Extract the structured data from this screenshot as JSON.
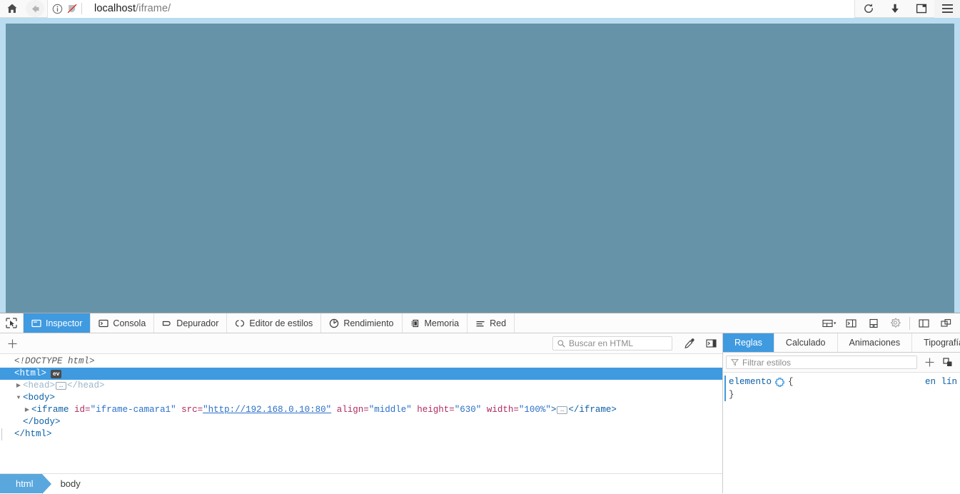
{
  "browser": {
    "home_tooltip": "Inicio",
    "back_tooltip": "Atrás",
    "url_host": "localhost",
    "url_path": "/iframe/",
    "reload_tooltip": "Recargar",
    "downloads_tooltip": "Descargas",
    "library_tooltip": "Biblioteca",
    "menu_tooltip": "Menú"
  },
  "devtools": {
    "tabs": [
      {
        "label": "Inspector",
        "icon": "inspector-icon",
        "active": true
      },
      {
        "label": "Consola",
        "icon": "console-icon",
        "active": false
      },
      {
        "label": "Depurador",
        "icon": "debugger-icon",
        "active": false
      },
      {
        "label": "Editor de estilos",
        "icon": "style-editor-icon",
        "active": false
      },
      {
        "label": "Rendimiento",
        "icon": "performance-icon",
        "active": false
      },
      {
        "label": "Memoria",
        "icon": "memory-icon",
        "active": false
      },
      {
        "label": "Red",
        "icon": "network-icon",
        "active": false
      }
    ],
    "toolbar_icons": [
      "responsive-design-mode-icon",
      "split-console-icon",
      "screenshot-icon",
      "settings-gear-icon",
      "dock-side-icon",
      "separate-window-icon"
    ],
    "picker_icon": "element-picker-icon"
  },
  "inspector": {
    "add_node_icon": "plus-icon",
    "search_placeholder": "Buscar en HTML",
    "search_value": "",
    "search_icon": "search-icon",
    "eyedropper_icon": "eyedropper-icon",
    "sidebar_toggle_icon": "panel-toggle-icon",
    "markup": {
      "doctype": "<!DOCTYPE html>",
      "html_open": "<html>",
      "html_badge": "ev",
      "head_open": "<head>",
      "head_close": "</head>",
      "body_open": "<body>",
      "body_close": "</body>",
      "html_close": "</html>",
      "iframe": {
        "tag_open": "<iframe",
        "attrs": [
          {
            "name": "id",
            "value": "\"iframe-camara1\""
          },
          {
            "name": "src",
            "value": "\"http://192.168.0.10:80\""
          },
          {
            "name": "align",
            "value": "\"middle\""
          },
          {
            "name": "height",
            "value": "\"630\""
          },
          {
            "name": "width",
            "value": "\"100%\""
          }
        ],
        "tag_close_bracket": ">",
        "tag_close": "</iframe>"
      },
      "collapsed_marker": "…"
    },
    "breadcrumbs": [
      {
        "label": "html",
        "active": true
      },
      {
        "label": "body",
        "active": false
      }
    ]
  },
  "rules": {
    "tabs": [
      {
        "label": "Reglas",
        "active": true
      },
      {
        "label": "Calculado",
        "active": false
      },
      {
        "label": "Animaciones",
        "active": false
      },
      {
        "label": "Tipografía",
        "active": false
      }
    ],
    "filter_placeholder": "Filtrar estilos",
    "filter_value": "",
    "filter_icon": "filter-icon",
    "add_rule_icon": "plus-icon",
    "pseudo_class_icon": "pseudo-class-icon",
    "rule": {
      "selector": "elemento",
      "toggle_icon": "gear-icon",
      "open_brace": "{",
      "close_brace": "}",
      "source": "en lín"
    }
  },
  "colors": {
    "accent": "#3f9ae0",
    "breadcrumb_active": "#5aa7dd",
    "iframe_bg": "#6793a8",
    "highlight_bg": "#b9dcf0",
    "chrome_bg": "#f9f9f9"
  }
}
